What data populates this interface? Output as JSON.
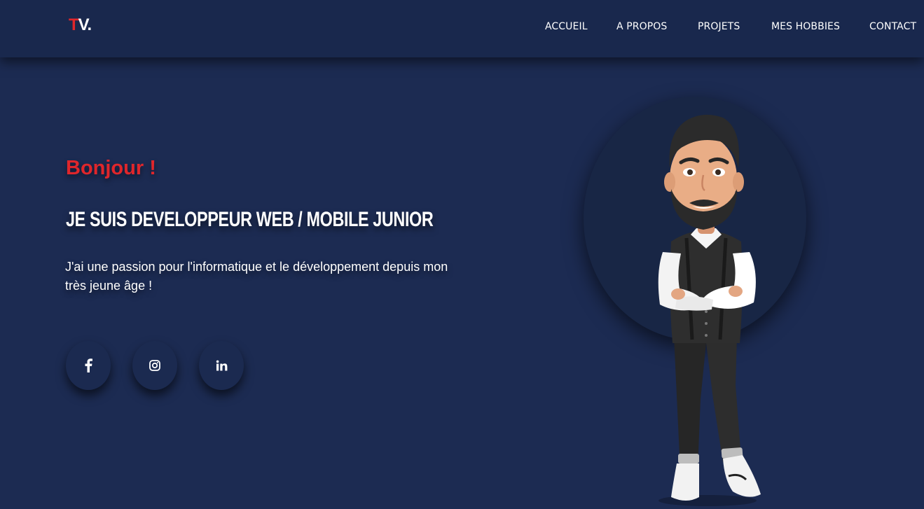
{
  "nav": {
    "logo_initial": "T",
    "logo_rest": "V.",
    "links": [
      "ACCUEIL",
      "A PROPOS",
      "PROJETS",
      "MES HOBBIES",
      "CONTACT"
    ]
  },
  "hero": {
    "greeting": "Bonjour !",
    "headline": "JE SUIS DEVELOPPEUR WEB / MOBILE JUNIOR",
    "intro": "J'ai une passion pour l'informatique et le développement depuis mon très jeune âge !"
  },
  "social": [
    {
      "name": "facebook-icon"
    },
    {
      "name": "instagram-icon"
    },
    {
      "name": "linkedin-icon"
    }
  ],
  "colors": {
    "background": "#1c2b52",
    "navbar": "#19284d",
    "accent": "#e0262b",
    "text": "#ffffff"
  }
}
